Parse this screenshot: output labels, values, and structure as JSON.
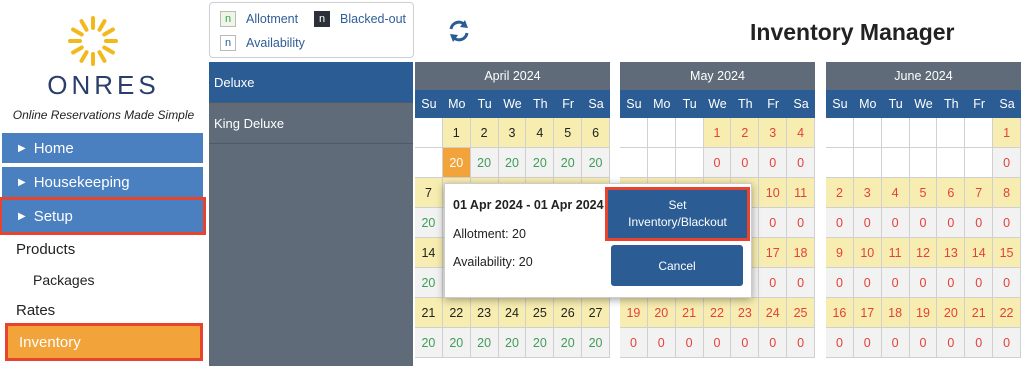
{
  "app": {
    "brand": "ONRES",
    "tagline": "Online Reservations Made Simple",
    "title": "Inventory Manager"
  },
  "colors": {
    "nav_blue": "#4a7fc0",
    "nav_active": "#f2a33a",
    "highlight_red": "#e8432e",
    "calendar_header": "#5f6b78",
    "dow_blue": "#2b5c93",
    "date_yellow": "#f7edb0",
    "green_num": "#3e9d58",
    "red_num": "#e3413a"
  },
  "sidebar": {
    "home": "Home",
    "housekeeping": "Housekeeping",
    "setup": "Setup",
    "products": "Products",
    "packages": "Packages",
    "rates": "Rates",
    "inventory": "Inventory"
  },
  "legend": {
    "allotment_box": "n",
    "allotment": "Allotment",
    "blacked_box": "n",
    "blacked_out": "Blacked-out",
    "availability_box": "n",
    "availability": "Availability"
  },
  "icons": {
    "refresh": "refresh-icon",
    "nav_arrow": "caret-right-icon",
    "logo": "sun-logo-icon"
  },
  "rooms": [
    "Deluxe",
    "King Deluxe"
  ],
  "dow": [
    "Su",
    "Mo",
    "Tu",
    "We",
    "Th",
    "Fr",
    "Sa"
  ],
  "calendars": [
    {
      "month": "April 2024",
      "rows": [
        [
          [
            "blank",
            ""
          ],
          [
            "date",
            "1"
          ],
          [
            "date",
            "2"
          ],
          [
            "date",
            "3"
          ],
          [
            "date",
            "4"
          ],
          [
            "date",
            "5"
          ],
          [
            "date",
            "6"
          ]
        ],
        [
          [
            "blank",
            ""
          ],
          [
            "today",
            "20"
          ],
          [
            "num20",
            "20"
          ],
          [
            "num20",
            "20"
          ],
          [
            "num20",
            "20"
          ],
          [
            "num20",
            "20"
          ],
          [
            "num20",
            "20"
          ]
        ],
        [
          [
            "date",
            "7"
          ],
          [
            "date",
            ""
          ],
          [
            "date",
            ""
          ],
          [
            "date",
            ""
          ],
          [
            "date",
            ""
          ],
          [
            "date",
            ""
          ],
          [
            "date",
            ""
          ]
        ],
        [
          [
            "num20",
            "20"
          ],
          [
            "num20",
            ""
          ],
          [
            "num20",
            ""
          ],
          [
            "num20",
            ""
          ],
          [
            "num20",
            ""
          ],
          [
            "num20",
            ""
          ],
          [
            "num20",
            ""
          ]
        ],
        [
          [
            "date",
            "14"
          ],
          [
            "date",
            ""
          ],
          [
            "date",
            ""
          ],
          [
            "date",
            ""
          ],
          [
            "date",
            ""
          ],
          [
            "date",
            ""
          ],
          [
            "date",
            ""
          ]
        ],
        [
          [
            "num20",
            "20"
          ],
          [
            "num20",
            ""
          ],
          [
            "num20",
            ""
          ],
          [
            "num20",
            ""
          ],
          [
            "num20",
            ""
          ],
          [
            "num20",
            ""
          ],
          [
            "num20",
            ""
          ]
        ],
        [
          [
            "date",
            "21"
          ],
          [
            "date",
            "22"
          ],
          [
            "date",
            "23"
          ],
          [
            "date",
            "24"
          ],
          [
            "date",
            "25"
          ],
          [
            "date",
            "26"
          ],
          [
            "date",
            "27"
          ]
        ],
        [
          [
            "num20",
            "20"
          ],
          [
            "num20",
            "20"
          ],
          [
            "num20",
            "20"
          ],
          [
            "num20",
            "20"
          ],
          [
            "num20",
            "20"
          ],
          [
            "num20",
            "20"
          ],
          [
            "num20",
            "20"
          ]
        ]
      ]
    },
    {
      "month": "May 2024",
      "rows": [
        [
          [
            "blank",
            ""
          ],
          [
            "blank",
            ""
          ],
          [
            "blank",
            ""
          ],
          [
            "redate",
            "1"
          ],
          [
            "redate",
            "2"
          ],
          [
            "redate",
            "3"
          ],
          [
            "redate",
            "4"
          ]
        ],
        [
          [
            "blank",
            ""
          ],
          [
            "blank",
            ""
          ],
          [
            "blank",
            ""
          ],
          [
            "num0",
            "0"
          ],
          [
            "num0",
            "0"
          ],
          [
            "num0",
            "0"
          ],
          [
            "num0",
            "0"
          ]
        ],
        [
          [
            "redate",
            ""
          ],
          [
            "redate",
            ""
          ],
          [
            "redate",
            ""
          ],
          [
            "redate",
            ""
          ],
          [
            "redate",
            ""
          ],
          [
            "redate",
            "10"
          ],
          [
            "redate",
            "11"
          ]
        ],
        [
          [
            "num0",
            ""
          ],
          [
            "num0",
            ""
          ],
          [
            "num0",
            ""
          ],
          [
            "num0",
            ""
          ],
          [
            "num0",
            ""
          ],
          [
            "num0",
            "0"
          ],
          [
            "num0",
            "0"
          ]
        ],
        [
          [
            "redate",
            ""
          ],
          [
            "redate",
            ""
          ],
          [
            "redate",
            ""
          ],
          [
            "redate",
            ""
          ],
          [
            "redate",
            ""
          ],
          [
            "redate",
            "17"
          ],
          [
            "redate",
            "18"
          ]
        ],
        [
          [
            "num0",
            ""
          ],
          [
            "num0",
            ""
          ],
          [
            "num0",
            ""
          ],
          [
            "num0",
            ""
          ],
          [
            "num0",
            ""
          ],
          [
            "num0",
            "0"
          ],
          [
            "num0",
            "0"
          ]
        ],
        [
          [
            "redate",
            "19"
          ],
          [
            "redate",
            "20"
          ],
          [
            "redate",
            "21"
          ],
          [
            "redate",
            "22"
          ],
          [
            "redate",
            "23"
          ],
          [
            "redate",
            "24"
          ],
          [
            "redate",
            "25"
          ]
        ],
        [
          [
            "num0",
            "0"
          ],
          [
            "num0",
            "0"
          ],
          [
            "num0",
            "0"
          ],
          [
            "num0",
            "0"
          ],
          [
            "num0",
            "0"
          ],
          [
            "num0",
            "0"
          ],
          [
            "num0",
            "0"
          ]
        ]
      ]
    },
    {
      "month": "June 2024",
      "rows": [
        [
          [
            "blank",
            ""
          ],
          [
            "blank",
            ""
          ],
          [
            "blank",
            ""
          ],
          [
            "blank",
            ""
          ],
          [
            "blank",
            ""
          ],
          [
            "blank",
            ""
          ],
          [
            "redate",
            "1"
          ]
        ],
        [
          [
            "blank",
            ""
          ],
          [
            "blank",
            ""
          ],
          [
            "blank",
            ""
          ],
          [
            "blank",
            ""
          ],
          [
            "blank",
            ""
          ],
          [
            "blank",
            ""
          ],
          [
            "num0",
            "0"
          ]
        ],
        [
          [
            "redate",
            "2"
          ],
          [
            "redate",
            "3"
          ],
          [
            "redate",
            "4"
          ],
          [
            "redate",
            "5"
          ],
          [
            "redate",
            "6"
          ],
          [
            "redate",
            "7"
          ],
          [
            "redate",
            "8"
          ]
        ],
        [
          [
            "num0",
            "0"
          ],
          [
            "num0",
            "0"
          ],
          [
            "num0",
            "0"
          ],
          [
            "num0",
            "0"
          ],
          [
            "num0",
            "0"
          ],
          [
            "num0",
            "0"
          ],
          [
            "num0",
            "0"
          ]
        ],
        [
          [
            "redate",
            "9"
          ],
          [
            "redate",
            "10"
          ],
          [
            "redate",
            "11"
          ],
          [
            "redate",
            "12"
          ],
          [
            "redate",
            "13"
          ],
          [
            "redate",
            "14"
          ],
          [
            "redate",
            "15"
          ]
        ],
        [
          [
            "num0",
            "0"
          ],
          [
            "num0",
            "0"
          ],
          [
            "num0",
            "0"
          ],
          [
            "num0",
            "0"
          ],
          [
            "num0",
            "0"
          ],
          [
            "num0",
            "0"
          ],
          [
            "num0",
            "0"
          ]
        ],
        [
          [
            "redate",
            "16"
          ],
          [
            "redate",
            "17"
          ],
          [
            "redate",
            "18"
          ],
          [
            "redate",
            "19"
          ],
          [
            "redate",
            "20"
          ],
          [
            "redate",
            "21"
          ],
          [
            "redate",
            "22"
          ]
        ],
        [
          [
            "num0",
            "0"
          ],
          [
            "num0",
            "0"
          ],
          [
            "num0",
            "0"
          ],
          [
            "num0",
            "0"
          ],
          [
            "num0",
            "0"
          ],
          [
            "num0",
            "0"
          ],
          [
            "num0",
            "0"
          ]
        ]
      ]
    }
  ],
  "popup": {
    "range": "01 Apr 2024 - 01 Apr 2024",
    "allotment": "Allotment: 20",
    "availability": "Availability: 20",
    "set_label_line1": "Set",
    "set_label_line2": "Inventory/Blackout",
    "cancel_label": "Cancel"
  }
}
